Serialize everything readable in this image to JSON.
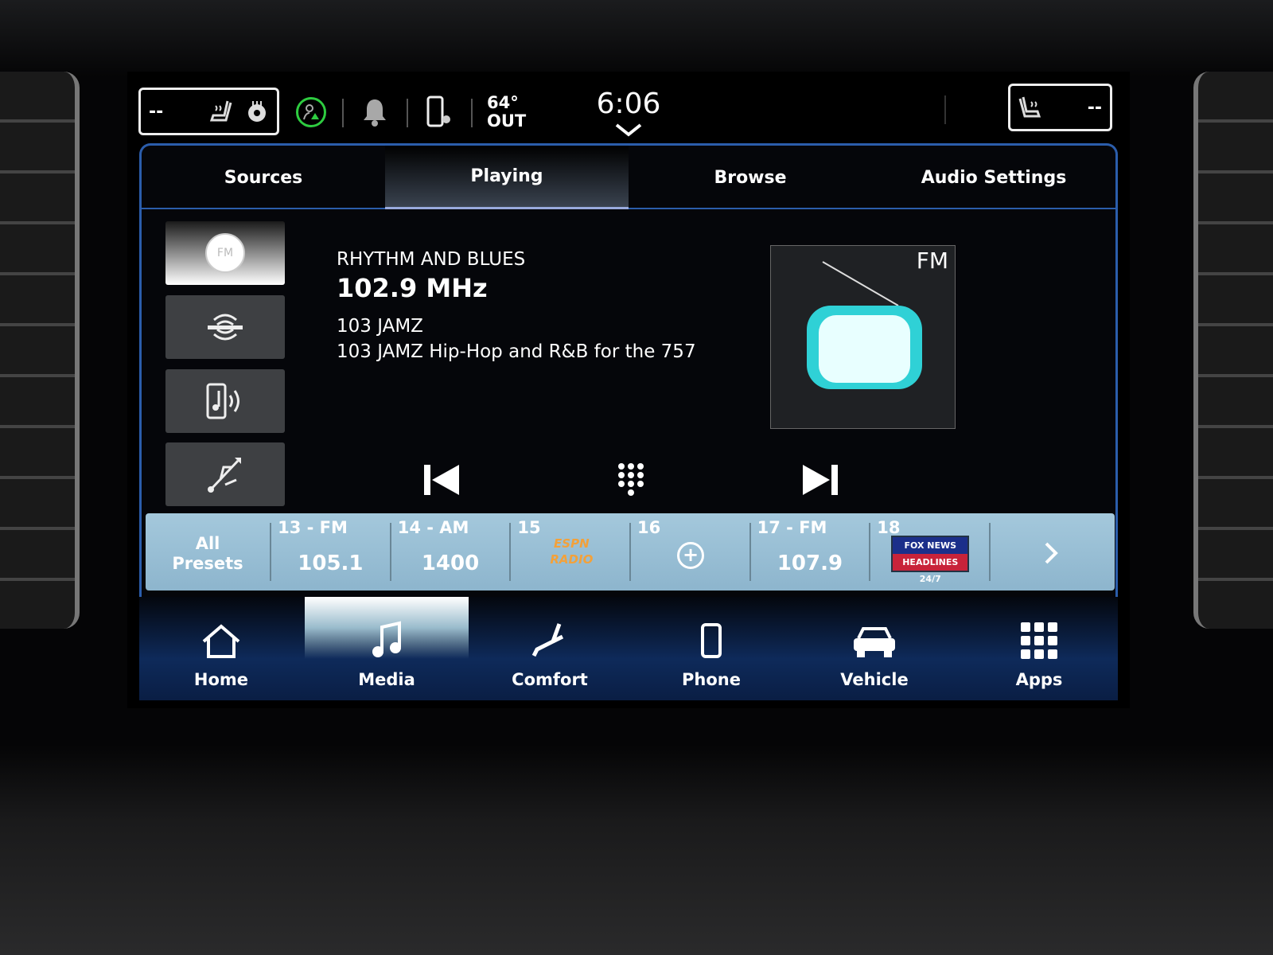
{
  "status_bar": {
    "left_seat_value": "--",
    "right_seat_value": "--",
    "temperature": "64°",
    "temperature_label": "OUT",
    "time": "6:06"
  },
  "tabs": [
    {
      "label": "Sources",
      "active": false
    },
    {
      "label": "Playing",
      "active": true
    },
    {
      "label": "Browse",
      "active": false
    },
    {
      "label": "Audio Settings",
      "active": false
    }
  ],
  "sources": [
    {
      "icon": "fm-radio-icon",
      "label": "FM",
      "active": true
    },
    {
      "icon": "siriusxm-icon",
      "active": false
    },
    {
      "icon": "bluetooth-audio-icon",
      "active": false
    },
    {
      "icon": "usb-icon",
      "active": false
    }
  ],
  "now_playing": {
    "genre": "RHYTHM AND BLUES",
    "frequency": "102.9 MHz",
    "station": "103 JAMZ",
    "description": "103 JAMZ Hip-Hop and R&B for the 757",
    "art_band": "FM"
  },
  "controls": {
    "prev": "seek-back-icon",
    "keypad": "keypad-icon",
    "next": "seek-forward-icon"
  },
  "presets": {
    "all_label_1": "All",
    "all_label_2": "Presets",
    "items": [
      {
        "label": "13 - FM",
        "value": "105.1"
      },
      {
        "label": "14 - AM",
        "value": "1400"
      },
      {
        "label": "15",
        "logo": "ESPN RADIO"
      },
      {
        "label": "16",
        "value": "+"
      },
      {
        "label": "17 - FM",
        "value": "107.9"
      },
      {
        "label": "18",
        "logo": "FOX NEWS HEADLINES 24/7"
      }
    ]
  },
  "nav": [
    {
      "label": "Home",
      "icon": "home-icon",
      "active": false
    },
    {
      "label": "Media",
      "icon": "music-note-icon",
      "active": true
    },
    {
      "label": "Comfort",
      "icon": "seat-icon",
      "active": false
    },
    {
      "label": "Phone",
      "icon": "phone-icon",
      "active": false
    },
    {
      "label": "Vehicle",
      "icon": "car-icon",
      "active": false
    },
    {
      "label": "Apps",
      "icon": "apps-grid-icon",
      "active": false
    }
  ],
  "colors": {
    "accent": "#2b5dab",
    "preset_bar": "#9cc2d8",
    "profile_ring": "#2ecc40"
  }
}
